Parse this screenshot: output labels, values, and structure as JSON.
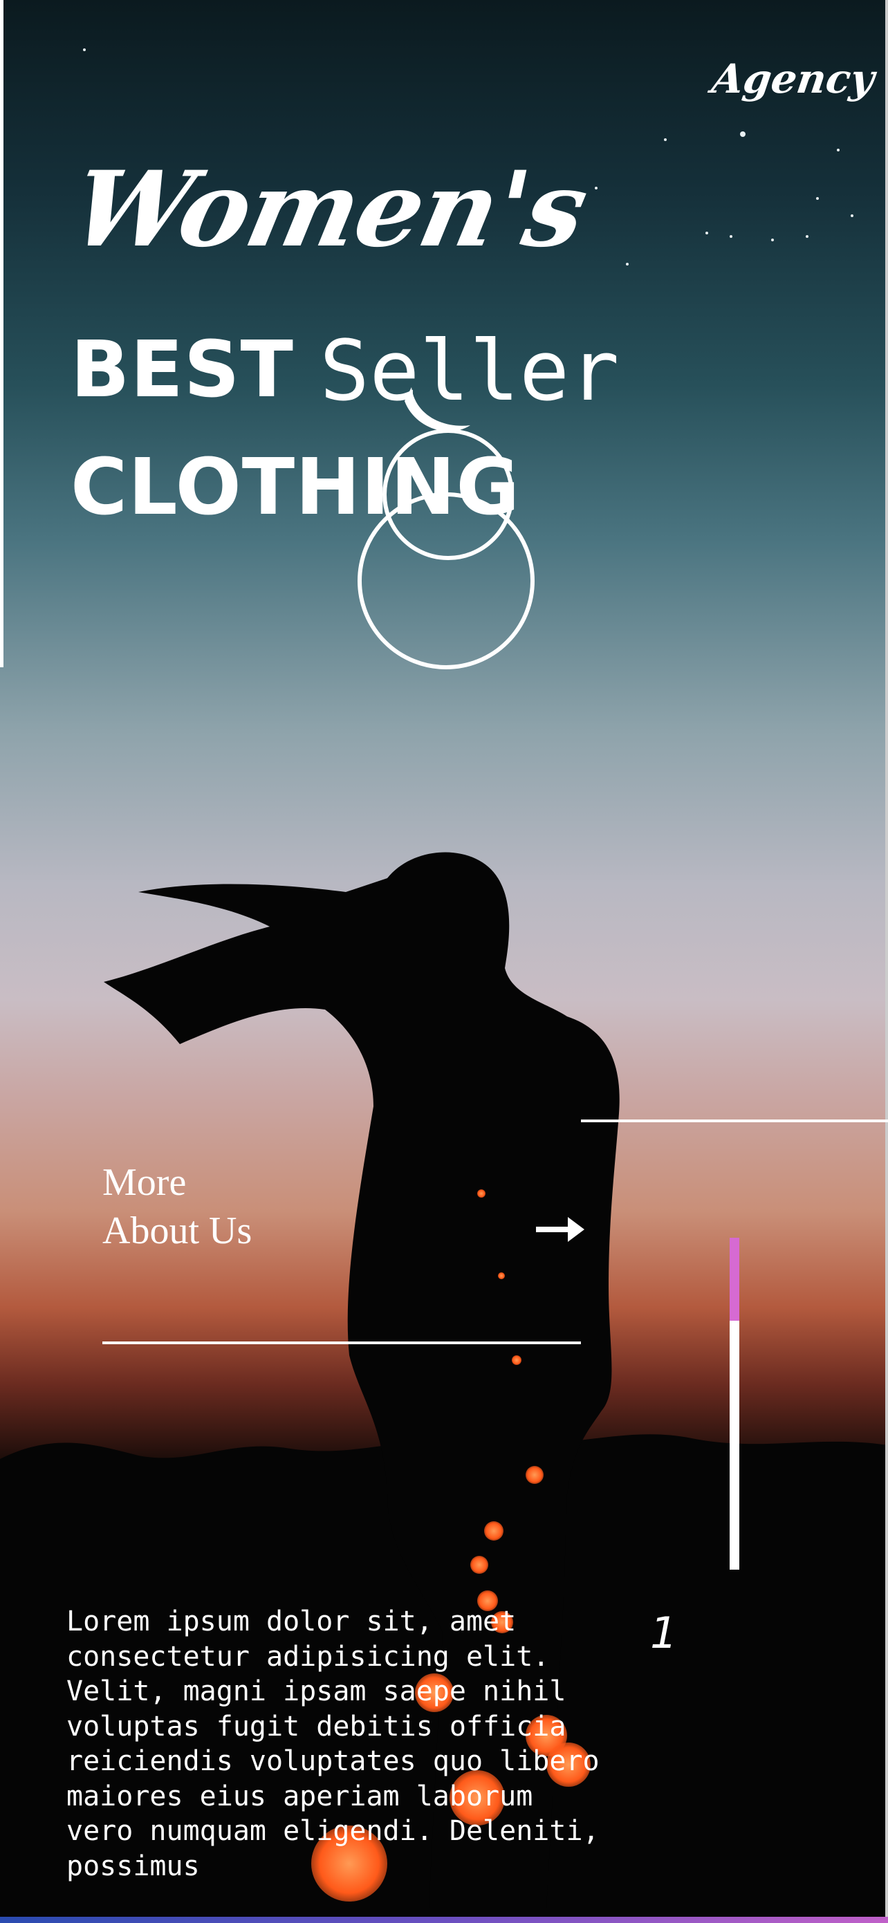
{
  "brand": {
    "name": "Agency"
  },
  "hero": {
    "title_script": "Women's",
    "title_bold_1": "BEST",
    "title_mono": "Seller",
    "title_bold_2": "CLOTHING"
  },
  "cta": {
    "label": "More About Us",
    "arrow_icon": "arrow-right-icon"
  },
  "pager": {
    "current": "1",
    "progress": 0.25,
    "accent": "#d66ad2"
  },
  "description": "Lorem ipsum dolor sit, amet consectetur adipisicing elit. Velit, magni ipsam saepe nihil voluptas fugit debitis officia reiciendis voluptates quo libero maiores eius aperiam laborum vero numquam eligendi. Deleniti, possimus",
  "colors": {
    "text": "#ffffff",
    "sky_top": "#0b1a1f",
    "sunset": "#c98f78",
    "ground": "#000000"
  }
}
